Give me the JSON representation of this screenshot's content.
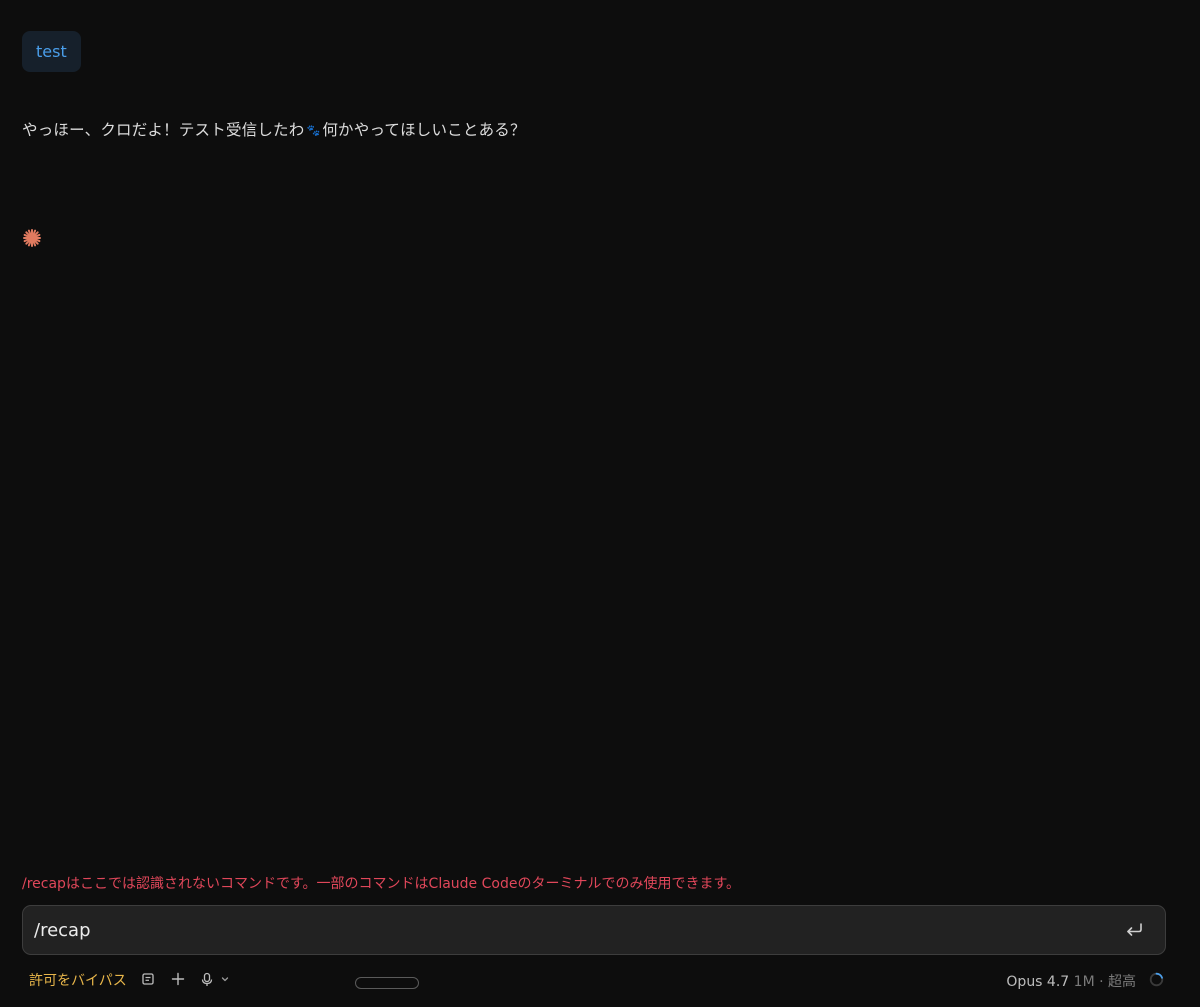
{
  "conversation": {
    "user_message": "test",
    "assistant_message_before_icon": "やっほー、クロだよ！テスト受信したわ",
    "assistant_message_icon": "paw-icon",
    "assistant_message_after_icon": "何かやってほしいことある？",
    "loading_icon": "asterisk-spinner-icon"
  },
  "error": {
    "text": "/recapはここでは認識されないコマンドです。一部のコマンドはClaude Codeのターミナルでのみ使用できます。"
  },
  "input": {
    "value": "/recap",
    "send_icon": "enter-return-icon"
  },
  "toolbar": {
    "permission_mode": "許可をバイパス",
    "icons": [
      "document-icon",
      "plus-icon",
      "microphone-icon",
      "chevron-down-icon"
    ]
  },
  "model": {
    "name": "Opus 4.7",
    "context": "1M · 超高",
    "context_usage": 0.2
  },
  "colors": {
    "background": "#0d0d0d",
    "user_bubble_bg": "#16202b",
    "user_text": "#4a9eea",
    "error": "#e0475a",
    "permission": "#e8b64a",
    "accent_spinner": "#e07a5f"
  }
}
